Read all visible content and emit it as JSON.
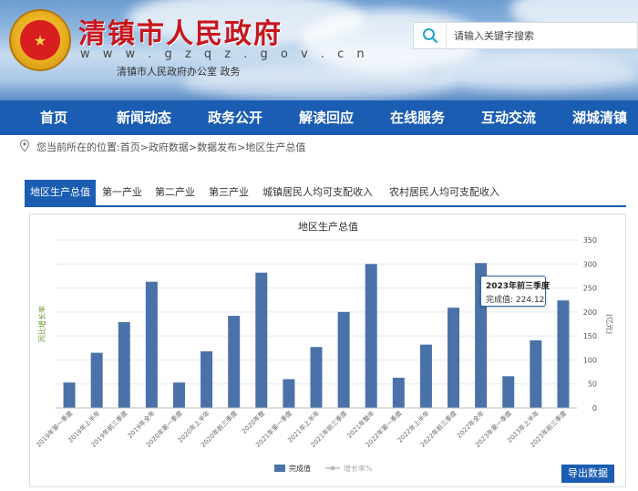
{
  "header": {
    "site_title": "清镇市人民政府",
    "site_url": "w w w . g z q z . g o v . c n",
    "site_subtitle": "清镇市人民政府办公室 政务",
    "emblem_glyph": "★",
    "search": {
      "placeholder": "请输入关键字搜索"
    }
  },
  "nav": {
    "items": [
      "首页",
      "新闻动态",
      "政务公开",
      "解读回应",
      "在线服务",
      "互动交流",
      "湖城清镇"
    ]
  },
  "breadcrumb": {
    "prefix": "您当前所在的位置:",
    "items": [
      "首页",
      "政府数据",
      "数据发布",
      "地区生产总值"
    ],
    "separator": " > "
  },
  "tabs": {
    "items": [
      "地区生产总值",
      "第一产业",
      "第二产业",
      "第三产业",
      "城镇居民人均可支配收入",
      "农村居民人均可支配收入"
    ],
    "active": 0
  },
  "export_label": "导出数据",
  "tooltip": {
    "title": "2023年前三季度",
    "label": "完成值:",
    "value": "224.12"
  },
  "colors": {
    "brand": "#1b5db3",
    "bar": "#4a72a8",
    "title_red": "#c8161d",
    "axis_left_label": "#6a9a2a"
  },
  "chart_data": {
    "type": "bar",
    "title": "地区生产总值",
    "categories": [
      "2019年第一季度",
      "2019年上半年",
      "2019年前三季度",
      "2019年全年",
      "2020年第一季度",
      "2020年上半年",
      "2020年前三季度",
      "2020年整",
      "2021年第一季度",
      "2021年上半年",
      "2021年前三季度",
      "2021年整年",
      "2022年第一季度",
      "2022年上半年",
      "2022年前三季度",
      "2022年全年",
      "2023年第一季度",
      "2023年上半年",
      "2023年前三季度"
    ],
    "series": [
      {
        "name": "完成值",
        "values": [
          53,
          115,
          179,
          263,
          53,
          118,
          192,
          282,
          60,
          127,
          200,
          300,
          63,
          132,
          209,
          302,
          66,
          141,
          224.12
        ]
      }
    ],
    "y_right_label": "(亿元)",
    "y_left_label": "同比增长率",
    "ylim": [
      0,
      350
    ],
    "yticks": [
      0,
      50,
      100,
      150,
      200,
      250,
      300,
      350
    ],
    "legend": [
      {
        "name": "完成值",
        "active": true
      },
      {
        "name": "增长率%",
        "active": false
      }
    ],
    "legend_position": "bottom",
    "grid": true
  }
}
